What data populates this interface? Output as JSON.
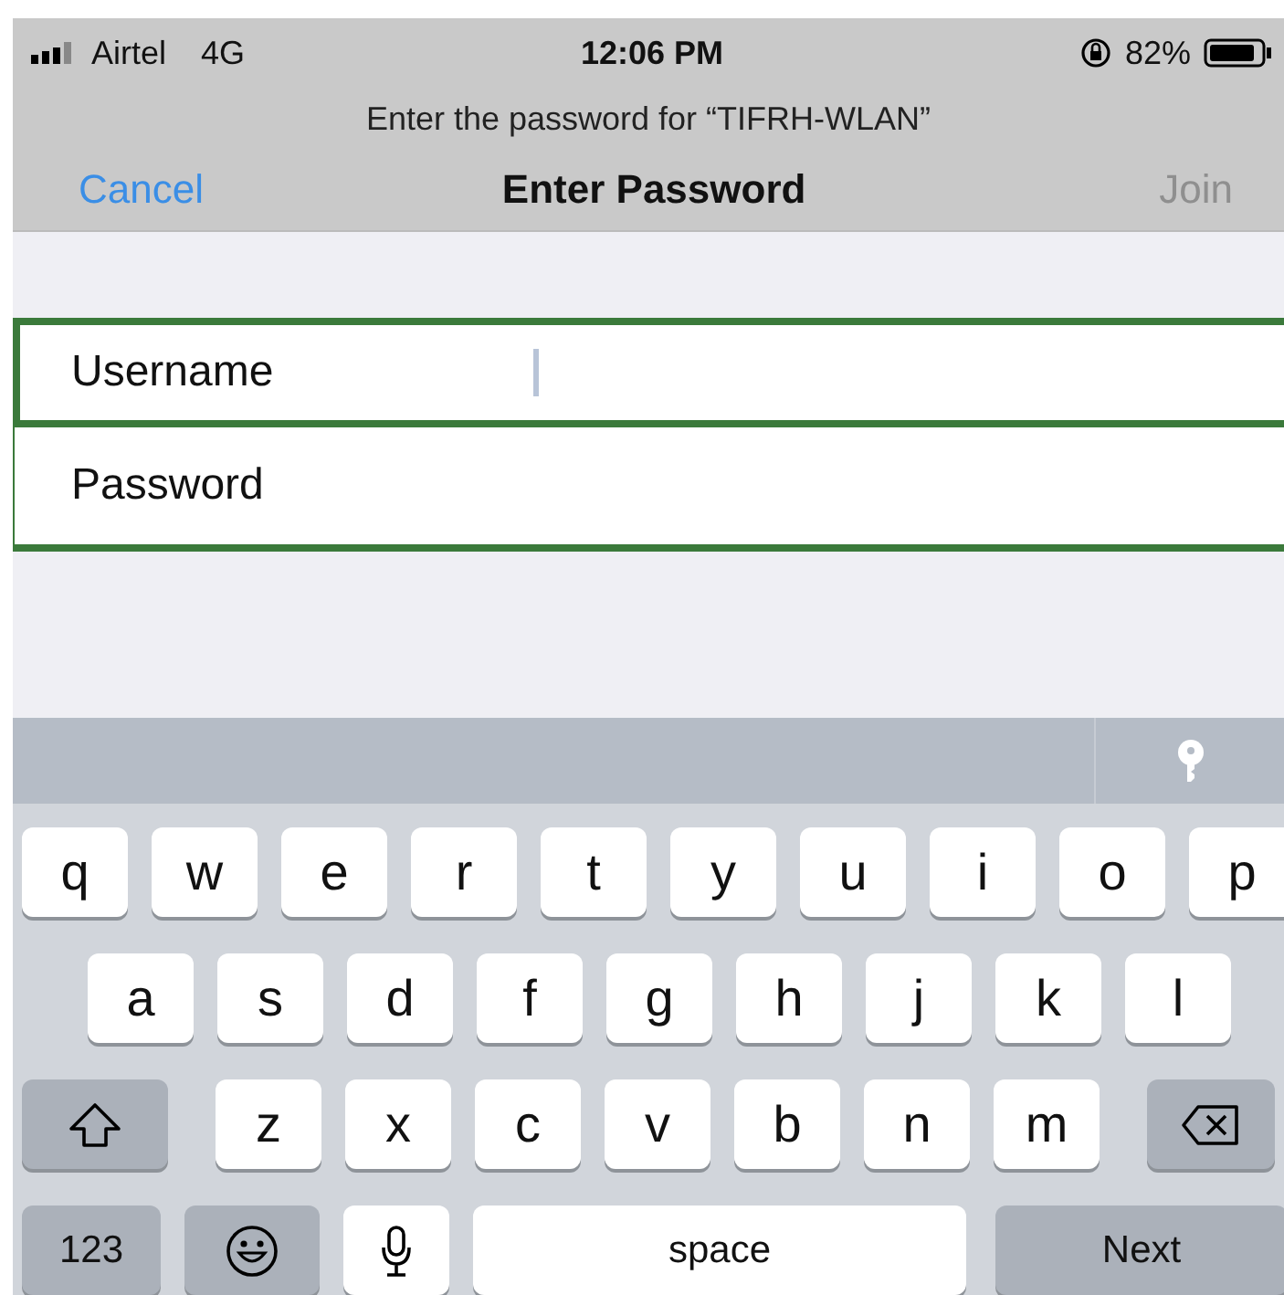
{
  "status_bar": {
    "carrier": "Airtel",
    "network": "4G",
    "time": "12:06 PM",
    "battery_percent": "82%"
  },
  "prompt": "Enter the password for “TIFRH-WLAN”",
  "nav": {
    "cancel": "Cancel",
    "title": "Enter Password",
    "join": {
      "label": "Join",
      "disabled": true
    }
  },
  "fields": [
    {
      "label": "Username",
      "focused": true
    },
    {
      "label": "Password",
      "focused": false
    }
  ],
  "keyboard": {
    "rows": [
      {
        "keys": [
          {
            "kind": "letter",
            "label": "q"
          },
          {
            "kind": "letter",
            "label": "w"
          },
          {
            "kind": "letter",
            "label": "e"
          },
          {
            "kind": "letter",
            "label": "r"
          },
          {
            "kind": "letter",
            "label": "t"
          },
          {
            "kind": "letter",
            "label": "y"
          },
          {
            "kind": "letter",
            "label": "u"
          },
          {
            "kind": "letter",
            "label": "i"
          },
          {
            "kind": "letter",
            "label": "o"
          },
          {
            "kind": "letter",
            "label": "p"
          }
        ]
      },
      {
        "keys": [
          {
            "kind": "letter",
            "label": "a"
          },
          {
            "kind": "letter",
            "label": "s"
          },
          {
            "kind": "letter",
            "label": "d"
          },
          {
            "kind": "letter",
            "label": "f"
          },
          {
            "kind": "letter",
            "label": "g"
          },
          {
            "kind": "letter",
            "label": "h"
          },
          {
            "kind": "letter",
            "label": "j"
          },
          {
            "kind": "letter",
            "label": "k"
          },
          {
            "kind": "letter",
            "label": "l"
          }
        ]
      },
      {
        "keys": [
          {
            "kind": "shift"
          },
          {
            "kind": "letter",
            "label": "z"
          },
          {
            "kind": "letter",
            "label": "x"
          },
          {
            "kind": "letter",
            "label": "c"
          },
          {
            "kind": "letter",
            "label": "v"
          },
          {
            "kind": "letter",
            "label": "b"
          },
          {
            "kind": "letter",
            "label": "n"
          },
          {
            "kind": "letter",
            "label": "m"
          },
          {
            "kind": "delete"
          }
        ]
      },
      {
        "keys": [
          {
            "kind": "numbers",
            "label": "123"
          },
          {
            "kind": "emoji"
          },
          {
            "kind": "mic"
          },
          {
            "kind": "space",
            "label": "space"
          },
          {
            "kind": "return",
            "label": "Next"
          }
        ]
      }
    ]
  }
}
